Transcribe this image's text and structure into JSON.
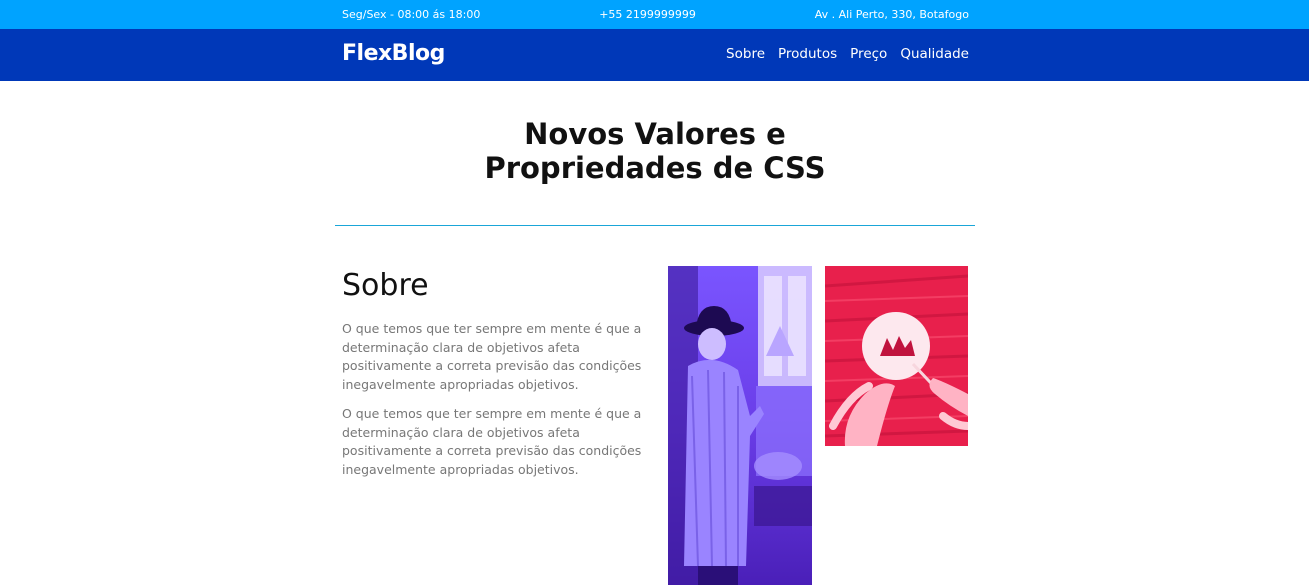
{
  "topbar": {
    "hours": "Seg/Sex - 08:00 ás 18:00",
    "phone": "+55 2199999999",
    "address": "Av . Ali Perto, 330, Botafogo"
  },
  "header": {
    "logo": "FlexBlog",
    "nav": [
      "Sobre",
      "Produtos",
      "Preço",
      "Qualidade"
    ]
  },
  "hero": {
    "title_line1": "Novos Valores e",
    "title_line2": "Propriedades de CSS"
  },
  "about": {
    "heading": "Sobre",
    "paragraphs": [
      "O que temos que ter sempre em mente é que a determinação clara de objetivos afeta positivamente a correta previsão das condições inegavelmente apropriadas objetivos.",
      "O que temos que ter sempre em mente é que a determinação clara de objetivos afeta positivamente a correta previsão das condições inegavelmente apropriadas objetivos."
    ]
  },
  "colors": {
    "topbar": "#00a3ff",
    "navbar": "#0038b8",
    "divider": "#1aa6d8",
    "photo1_tint": "#6a3dff",
    "photo2_tint": "#f0204e"
  }
}
